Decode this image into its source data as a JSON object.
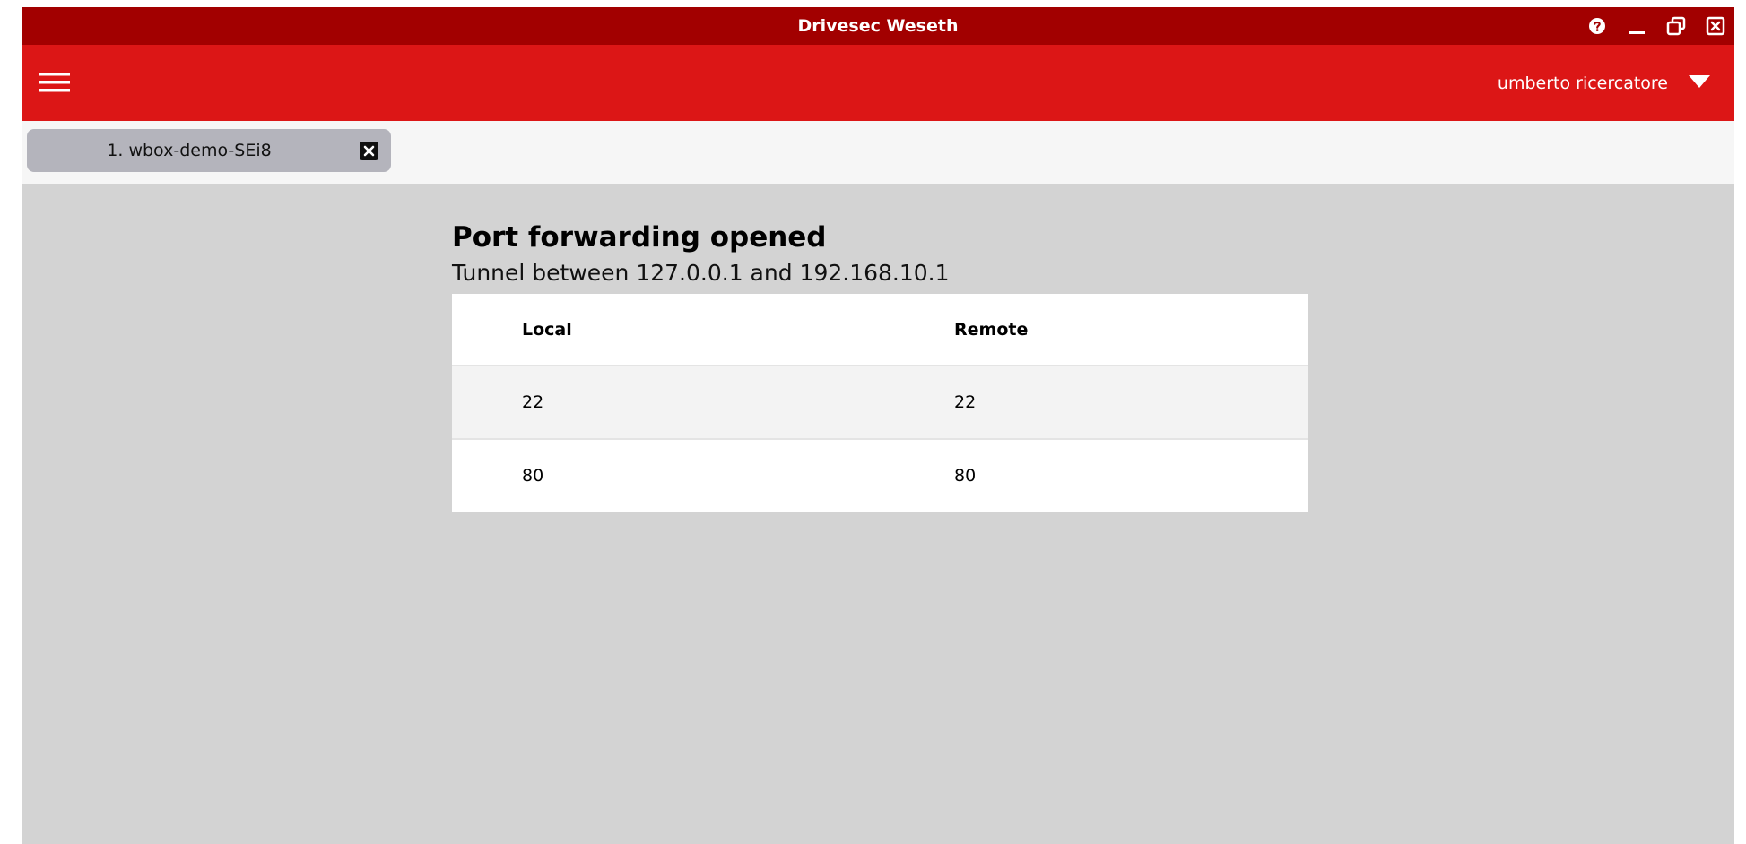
{
  "window": {
    "title": "Drivesec Weseth",
    "controls": [
      "help-icon",
      "minimize-icon",
      "restore-icon",
      "close-icon"
    ]
  },
  "appbar": {
    "menu_icon": "hamburger-menu-icon",
    "user_name": "umberto ricercatore",
    "user_menu_icon": "caret-down-icon"
  },
  "tabs": [
    {
      "label": "1. wbox-demo-SEi8",
      "close_icon": "close-box-icon"
    }
  ],
  "main": {
    "heading": "Port forwarding opened",
    "subtitle": "Tunnel between 127.0.0.1 and 192.168.10.1",
    "table": {
      "columns": [
        "Local",
        "Remote"
      ],
      "rows": [
        [
          "22",
          "22"
        ],
        [
          "80",
          "80"
        ]
      ]
    }
  },
  "colors": {
    "titlebar": "#a20000",
    "appbar": "#dc1616",
    "background": "#d3d3d3",
    "tab": "#b4b4bc"
  }
}
